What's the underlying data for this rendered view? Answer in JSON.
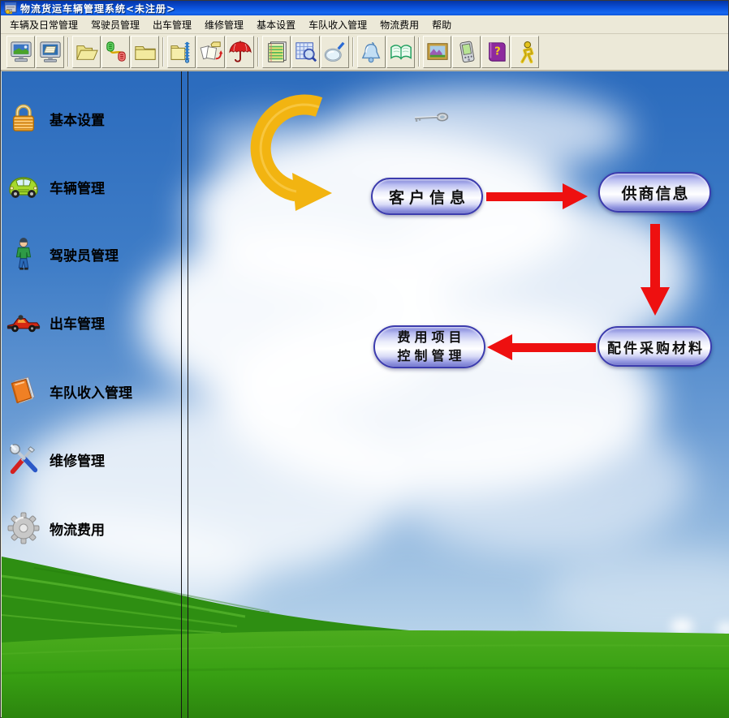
{
  "window": {
    "title": "物流货运车辆管理系统<未注册>"
  },
  "menubar": {
    "items": [
      "车辆及日常管理",
      "驾驶员管理",
      "出车管理",
      "维修管理",
      "基本设置",
      "车队收入管理",
      "物流费用",
      "帮助"
    ]
  },
  "toolbar": {
    "buttons": [
      {
        "icon": "desktop-monitor-icon"
      },
      {
        "icon": "print-preview-icon"
      },
      {
        "icon": "open-folder-icon"
      },
      {
        "icon": "data-link-icon"
      },
      {
        "icon": "folder-icon"
      },
      {
        "icon": "compress-backup-icon"
      },
      {
        "icon": "restore-docs-icon"
      },
      {
        "icon": "umbrella-protect-icon"
      },
      {
        "icon": "notebook-records-icon"
      },
      {
        "icon": "table-search-icon"
      },
      {
        "icon": "magnifier-icon"
      },
      {
        "icon": "bell-remind-icon"
      },
      {
        "icon": "open-book-icon"
      },
      {
        "icon": "picture-icon"
      },
      {
        "icon": "pda-icon"
      },
      {
        "icon": "help-book-icon"
      },
      {
        "icon": "exit-running-man-icon"
      }
    ]
  },
  "sidebar": {
    "items": [
      {
        "label": "基本设置",
        "icon": "lock-icon"
      },
      {
        "label": "车辆管理",
        "icon": "car-icon"
      },
      {
        "label": "驾驶员管理",
        "icon": "driver-icon"
      },
      {
        "label": "出车管理",
        "icon": "race-car-icon"
      },
      {
        "label": "车队收入管理",
        "icon": "income-book-icon"
      },
      {
        "label": "维修管理",
        "icon": "repair-tools-icon"
      },
      {
        "label": "物流费用",
        "icon": "gear-icon"
      }
    ]
  },
  "diagram": {
    "customer_label": "客户信息",
    "supplier_label": "供商信息",
    "expense_label_line1": "费用项目",
    "expense_label_line2": "控制管理",
    "parts_label": "配件采购材料",
    "flow": [
      {
        "from": "客户信息",
        "to": "供商信息"
      },
      {
        "from": "供商信息",
        "to": "配件采购材料"
      },
      {
        "from": "配件采购材料",
        "to": "费用项目控制管理"
      }
    ],
    "arrow_color": "#ee1010",
    "swirl_arrow_color": "#f2b411"
  },
  "colors": {
    "titlebar_blue": "#0a4fd8",
    "chrome_beige": "#ece9d8",
    "sky_blue": "#2b6bbd",
    "grass_green": "#3fa315",
    "pill_border": "#3c3cae"
  }
}
